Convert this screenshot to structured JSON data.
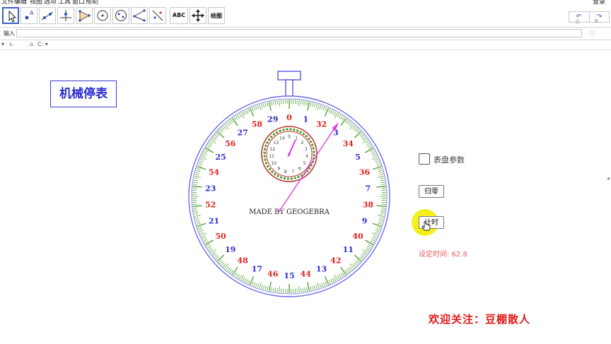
{
  "menu": [
    "文件",
    "编辑",
    "视图",
    "选项",
    "工具",
    "窗口",
    "帮助"
  ],
  "login": "登录",
  "toolbar": {
    "text_tool": "ABC",
    "draw_tool": "绘图"
  },
  "input_bar": {
    "label": "输入",
    "value": ""
  },
  "stylebar": {
    "view_label": "C:"
  },
  "title": "机械停表",
  "dial": {
    "outer_labels": [
      {
        "v": "0",
        "c": "red"
      },
      {
        "v": "1",
        "c": "blue"
      },
      {
        "v": "32",
        "c": "red"
      },
      {
        "v": "3",
        "c": "blue"
      },
      {
        "v": "34",
        "c": "red"
      },
      {
        "v": "5",
        "c": "blue"
      },
      {
        "v": "36",
        "c": "red"
      },
      {
        "v": "7",
        "c": "blue"
      },
      {
        "v": "38",
        "c": "red"
      },
      {
        "v": "9",
        "c": "blue"
      },
      {
        "v": "40",
        "c": "red"
      },
      {
        "v": "11",
        "c": "blue"
      },
      {
        "v": "42",
        "c": "red"
      },
      {
        "v": "13",
        "c": "blue"
      },
      {
        "v": "44",
        "c": "red"
      },
      {
        "v": "15",
        "c": "blue"
      },
      {
        "v": "46",
        "c": "red"
      },
      {
        "v": "17",
        "c": "blue"
      },
      {
        "v": "48",
        "c": "red"
      },
      {
        "v": "19",
        "c": "blue"
      },
      {
        "v": "50",
        "c": "red"
      },
      {
        "v": "21",
        "c": "blue"
      },
      {
        "v": "52",
        "c": "red"
      },
      {
        "v": "23",
        "c": "blue"
      },
      {
        "v": "54",
        "c": "red"
      },
      {
        "v": "25",
        "c": "blue"
      },
      {
        "v": "56",
        "c": "red"
      },
      {
        "v": "27",
        "c": "blue"
      },
      {
        "v": "58",
        "c": "red"
      },
      {
        "v": "29",
        "c": "blue"
      }
    ],
    "inner_labels": [
      "0",
      "1",
      "2",
      "3",
      "4",
      "5",
      "6",
      "7",
      "8",
      "9",
      "10",
      "11",
      "12",
      "13",
      "14"
    ],
    "credit": "MADE BY GEOGEBRA",
    "second_value": 2.8,
    "minute_value": 1.0
  },
  "controls": {
    "params_label": "表盘参数",
    "reset_label": "归零",
    "time_label": "计时",
    "set_time": "设定时间: 62.8"
  },
  "footer": "欢迎关注：豆棚散人",
  "colors": {
    "blue": "#2b2bd0",
    "red": "#e02020",
    "tick_green": "#4c9a2a",
    "hand": "#e040e0",
    "ring": "#6a6ae8"
  }
}
